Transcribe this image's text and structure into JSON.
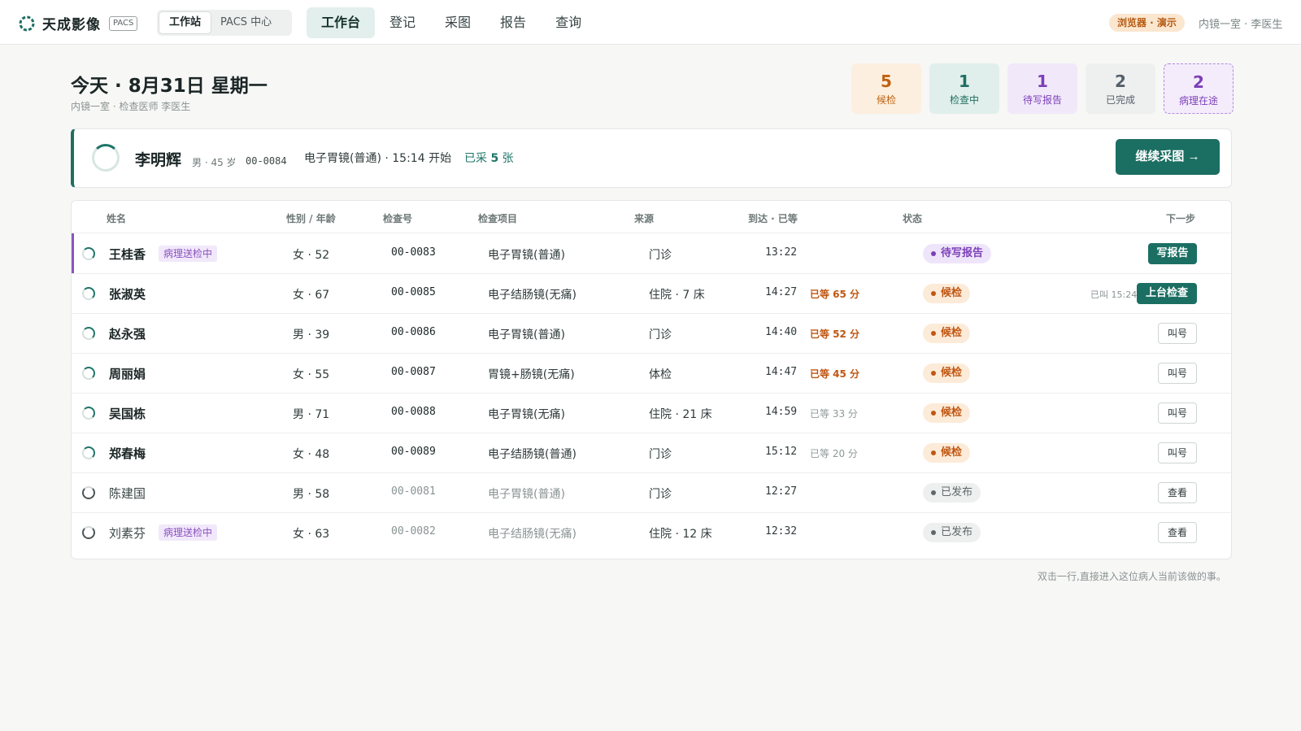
{
  "app": {
    "brand": "天成影像",
    "product_tag": "PACS",
    "modes": [
      "工作站",
      "PACS 中心"
    ],
    "nav": [
      "工作台",
      "登记",
      "采图",
      "报告",
      "查询"
    ],
    "env_badge": "浏览器 · 演示",
    "user": "内镜一室 · 李医生"
  },
  "header": {
    "title": "今天 · 8月31日 星期一",
    "subtitle": "内镜一室 · 检查医师 李医生"
  },
  "stats": [
    {
      "count": "5",
      "label": "候检",
      "color": "#c0600f",
      "bg": "#fcefdf"
    },
    {
      "count": "1",
      "label": "检查中",
      "color": "#1f6f62",
      "bg": "#e1efec"
    },
    {
      "count": "1",
      "label": "待写报告",
      "color": "#7c3fb8",
      "bg": "#f1e8fa"
    },
    {
      "count": "2",
      "label": "已完成",
      "color": "#55606a",
      "bg": "#eef0ef"
    },
    {
      "count": "2",
      "label": "病理在途",
      "color": "#7c3fb8",
      "bg": "#f4ecfb"
    }
  ],
  "current": {
    "name": "李明辉",
    "meta": "男 · 45 岁",
    "id": "00-0084",
    "exam": "电子胃镜(普通) · 15:14 开始",
    "shots_prefix": "已采",
    "shots_count": "5",
    "shots_suffix": "张",
    "action": "继续采图 →"
  },
  "table": {
    "columns": [
      "姓名",
      "性别 / 年龄",
      "检查号",
      "检查项目",
      "来源",
      "到达 · 已等",
      "状态",
      "下一步"
    ],
    "rows": [
      {
        "name": "王桂香",
        "tag": "病理送检中",
        "sex_age": "女 · 52",
        "id": "00-0083",
        "exam": "电子胃镜(普通)",
        "source": "门诊",
        "arrival": "13:22",
        "wait": "",
        "status": "待写报告",
        "note": "",
        "action": "写报告"
      },
      {
        "name": "张淑英",
        "tag": "",
        "sex_age": "女 · 67",
        "id": "00-0085",
        "exam": "电子结肠镜(无痛)",
        "source": "住院 · 7 床",
        "arrival": "14:27",
        "wait": "已等 65 分",
        "status": "候检",
        "note": "已叫 15:24",
        "action": "上台检查"
      },
      {
        "name": "赵永强",
        "tag": "",
        "sex_age": "男 · 39",
        "id": "00-0086",
        "exam": "电子胃镜(普通)",
        "source": "门诊",
        "arrival": "14:40",
        "wait": "已等 52 分",
        "status": "候检",
        "note": "",
        "action": "叫号"
      },
      {
        "name": "周丽娟",
        "tag": "",
        "sex_age": "女 · 55",
        "id": "00-0087",
        "exam": "胃镜+肠镜(无痛)",
        "source": "体检",
        "arrival": "14:47",
        "wait": "已等 45 分",
        "status": "候检",
        "note": "",
        "action": "叫号"
      },
      {
        "name": "吴国栋",
        "tag": "",
        "sex_age": "男 · 71",
        "id": "00-0088",
        "exam": "电子胃镜(无痛)",
        "source": "住院 · 21 床",
        "arrival": "14:59",
        "wait": "已等 33 分",
        "status": "候检",
        "note": "",
        "action": "叫号"
      },
      {
        "name": "郑春梅",
        "tag": "",
        "sex_age": "女 · 48",
        "id": "00-0089",
        "exam": "电子结肠镜(普通)",
        "source": "门诊",
        "arrival": "15:12",
        "wait": "已等 20 分",
        "status": "候检",
        "note": "",
        "action": "叫号"
      },
      {
        "name": "陈建国",
        "tag": "",
        "sex_age": "男 · 58",
        "id": "00-0081",
        "exam": "电子胃镜(普通)",
        "source": "门诊",
        "arrival": "12:27",
        "wait": "",
        "status": "已发布",
        "note": "",
        "action": "查看"
      },
      {
        "name": "刘素芬",
        "tag": "病理送检中",
        "sex_age": "女 · 63",
        "id": "00-0082",
        "exam": "电子结肠镜(无痛)",
        "source": "住院 · 12 床",
        "arrival": "12:32",
        "wait": "",
        "status": "已发布",
        "note": "",
        "action": "查看"
      }
    ]
  },
  "footnote": "双击一行,直接进入这位病人当前该做的事。"
}
